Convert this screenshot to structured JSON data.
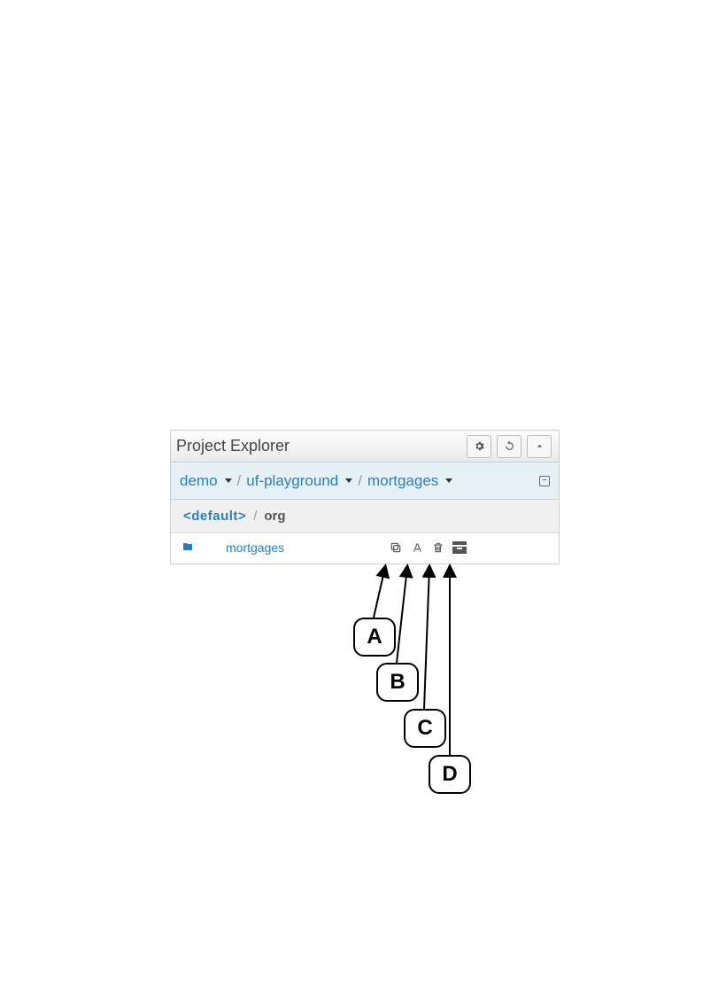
{
  "header": {
    "title": "Project Explorer"
  },
  "breadcrumb": {
    "items": [
      "demo",
      "uf-playground",
      "mortgages"
    ]
  },
  "path": {
    "default_label": "<default>",
    "last": "org"
  },
  "item": {
    "name": "mortgages"
  },
  "callouts": {
    "a": "A",
    "b": "B",
    "c": "C",
    "d": "D"
  }
}
